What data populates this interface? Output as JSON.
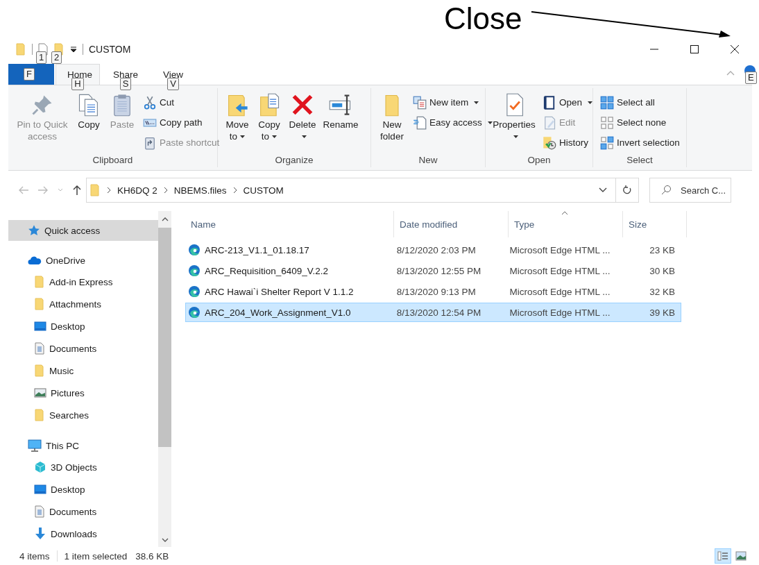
{
  "annotation": {
    "text": "Close"
  },
  "title_bar": {
    "title": "CUSTOM",
    "keytips": [
      "1",
      "2"
    ]
  },
  "file_tab": {
    "keytip": "F"
  },
  "tabs": [
    {
      "label": "Home",
      "keytip": "H",
      "selected": true
    },
    {
      "label": "Share",
      "keytip": "S",
      "selected": false
    },
    {
      "label": "View",
      "keytip": "V",
      "selected": false
    }
  ],
  "help": {
    "keytip": "E"
  },
  "ribbon": {
    "groups": [
      {
        "name": "Clipboard",
        "commands": [
          {
            "label": "Pin to Quick access",
            "kind": "large",
            "disabled": true,
            "dropdown": false
          },
          {
            "label": "Copy",
            "kind": "large",
            "disabled": false,
            "dropdown": false
          },
          {
            "label": "Paste",
            "kind": "large",
            "disabled": true,
            "dropdown": false
          },
          {
            "label": "Cut",
            "kind": "small",
            "disabled": false,
            "dropdown": false
          },
          {
            "label": "Copy path",
            "kind": "small",
            "disabled": false,
            "dropdown": false
          },
          {
            "label": "Paste shortcut",
            "kind": "small",
            "disabled": true,
            "dropdown": false
          }
        ]
      },
      {
        "name": "Organize",
        "commands": [
          {
            "label": "Move to",
            "kind": "large",
            "disabled": false,
            "dropdown": true
          },
          {
            "label": "Copy to",
            "kind": "large",
            "disabled": false,
            "dropdown": true
          },
          {
            "label": "Delete",
            "kind": "large",
            "disabled": false,
            "dropdown": true
          },
          {
            "label": "Rename",
            "kind": "large",
            "disabled": false,
            "dropdown": false
          }
        ]
      },
      {
        "name": "New",
        "commands": [
          {
            "label": "New folder",
            "kind": "large",
            "disabled": false,
            "dropdown": false
          },
          {
            "label": "New item",
            "kind": "small",
            "disabled": false,
            "dropdown": true
          },
          {
            "label": "Easy access",
            "kind": "small",
            "disabled": false,
            "dropdown": true
          }
        ]
      },
      {
        "name": "Open",
        "commands": [
          {
            "label": "Properties",
            "kind": "large",
            "disabled": false,
            "dropdown": true
          },
          {
            "label": "Open",
            "kind": "small",
            "disabled": false,
            "dropdown": true
          },
          {
            "label": "Edit",
            "kind": "small",
            "disabled": true,
            "dropdown": false
          },
          {
            "label": "History",
            "kind": "small",
            "disabled": false,
            "dropdown": false
          }
        ]
      },
      {
        "name": "Select",
        "commands": [
          {
            "label": "Select all",
            "kind": "small",
            "disabled": false,
            "dropdown": false
          },
          {
            "label": "Select none",
            "kind": "small",
            "disabled": false,
            "dropdown": false
          },
          {
            "label": "Invert selection",
            "kind": "small",
            "disabled": false,
            "dropdown": false
          }
        ]
      }
    ]
  },
  "address": {
    "path": [
      "KH6DQ 2",
      "NBEMS.files",
      "CUSTOM"
    ],
    "search_placeholder": "Search C..."
  },
  "navigation": [
    {
      "label": "Quick access",
      "selected": true
    },
    {
      "label": "OneDrive",
      "selected": false,
      "children": [
        {
          "label": "Add-in Express",
          "selected": false
        },
        {
          "label": "Attachments",
          "selected": false
        },
        {
          "label": "Desktop",
          "selected": false
        },
        {
          "label": "Documents",
          "selected": false
        },
        {
          "label": "Music",
          "selected": false
        },
        {
          "label": "Pictures",
          "selected": false
        },
        {
          "label": "Searches",
          "selected": false
        }
      ]
    },
    {
      "label": "This PC",
      "selected": false,
      "children": [
        {
          "label": "3D Objects",
          "selected": false
        },
        {
          "label": "Desktop",
          "selected": false
        },
        {
          "label": "Documents",
          "selected": false
        },
        {
          "label": "Downloads",
          "selected": false
        }
      ]
    }
  ],
  "file_list": {
    "columns": [
      {
        "label": "Name",
        "sorted": false
      },
      {
        "label": "Date modified",
        "sorted": false
      },
      {
        "label": "Type",
        "sorted": true
      },
      {
        "label": "Size",
        "sorted": false
      }
    ],
    "rows": [
      {
        "name": "ARC-213_V1.1_01.18.17",
        "date": "8/12/2020 2:03 PM",
        "type": "Microsoft Edge HTML ...",
        "size": "23 KB",
        "selected": false
      },
      {
        "name": "ARC_Requisition_6409_V.2.2",
        "date": "8/13/2020 12:55 PM",
        "type": "Microsoft Edge HTML ...",
        "size": "30 KB",
        "selected": false
      },
      {
        "name": "ARC Hawai`i Shelter Report V 1.1.2",
        "date": "8/13/2020 9:13 PM",
        "type": "Microsoft Edge HTML ...",
        "size": "32 KB",
        "selected": false
      },
      {
        "name": "ARC_204_Work_Assignment_V1.0",
        "date": "8/13/2020 12:54 PM",
        "type": "Microsoft Edge HTML ...",
        "size": "39 KB",
        "selected": true
      }
    ]
  },
  "status_bar": {
    "item_count": "4 items",
    "selection": "1 item selected",
    "selection_size": "38.6 KB",
    "views": [
      {
        "selected": true
      },
      {
        "selected": false
      }
    ]
  }
}
